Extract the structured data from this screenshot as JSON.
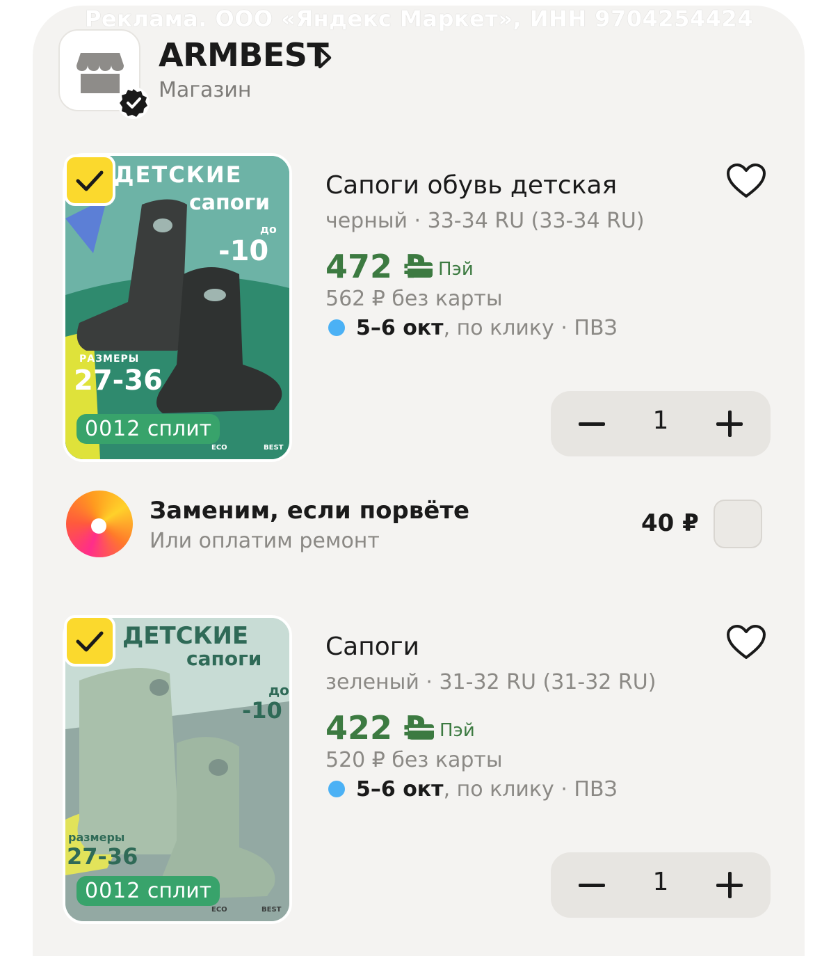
{
  "ad_disclaimer": "Реклама. ООО «Яндекс Маркет», ИНН 9704254424",
  "shop": {
    "name": "ARMBEST",
    "subtitle": "Магазин",
    "icons": {
      "logo": "store-icon",
      "verified": "verified-badge-icon",
      "chevron": "chevron-right-icon"
    }
  },
  "products": [
    {
      "title": "Сапоги  обувь детская",
      "variant": "черный · 33-34 RU (33-34 RU)",
      "price": "472 ₽",
      "pay_label": "Пэй",
      "price_no_card": "562 ₽  без карты",
      "delivery_bold": "5–6 окт",
      "delivery_rest": ", по клику · ПВЗ",
      "quantity": "1",
      "selected": true,
      "image": {
        "headline_1": "ДЕТСКИЕ",
        "headline_2": "сапоги",
        "promo_small": "до",
        "promo_big": "-10",
        "promo_unit": "%",
        "sizes_label": "РАЗМЕРЫ",
        "sizes": "27-36",
        "split_badge_num": "0012",
        "split_badge_text": "сплит",
        "footer_left": "ECO",
        "footer_right": "BEST",
        "boot_color": "#3a3d3c",
        "bg_color": "#4f9a8f"
      }
    },
    {
      "title": "Сапоги",
      "variant": "зеленый · 31-32 RU (31-32 RU)",
      "price": "422 ₽",
      "pay_label": "Пэй",
      "price_no_card": "520 ₽  без карты",
      "delivery_bold": "5–6 окт",
      "delivery_rest": ", по клику · ПВЗ",
      "quantity": "1",
      "selected": true,
      "image": {
        "headline_1": "ДЕТСКИЕ",
        "headline_2": "сапоги",
        "promo_small": "до",
        "promo_big": "-10",
        "promo_unit": "%",
        "sizes_label": "размеры",
        "sizes": "27-36",
        "split_badge_num": "0012",
        "split_badge_text": "сплит",
        "footer_left": "ECO",
        "footer_right": "BEST",
        "boot_color": "#a9c0ab",
        "bg_color": "#bcd4cc"
      }
    }
  ],
  "insurance": {
    "title": "Заменим, если порвёте",
    "subtitle": "Или оплатим ремонт",
    "price": "40 ₽",
    "checked": false
  },
  "colors": {
    "price_green": "#3c7a41",
    "delivery_dot": "#4bb1f5",
    "checkbox_yellow": "#fbd92d"
  }
}
